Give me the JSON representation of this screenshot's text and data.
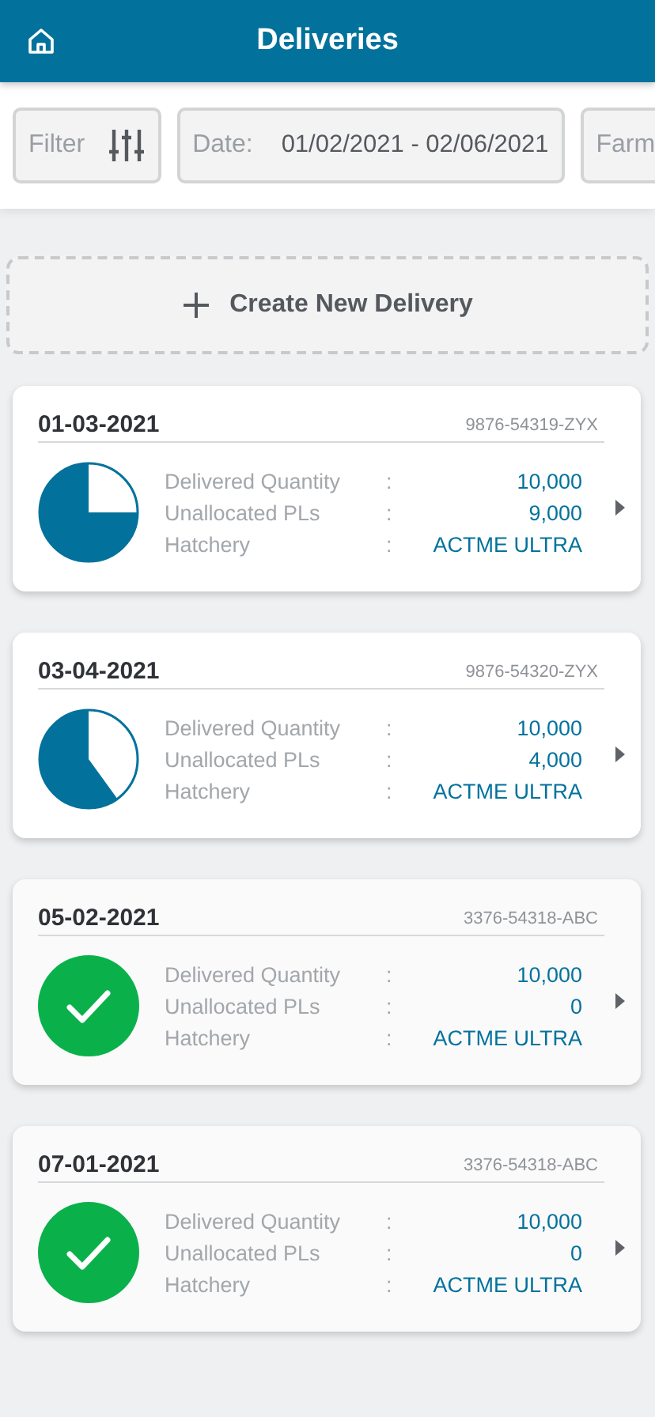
{
  "header": {
    "title": "Deliveries"
  },
  "filters": [
    {
      "kind": "filter",
      "label": "Filter"
    },
    {
      "kind": "date",
      "label": "Date:",
      "value": "01/02/2021 - 02/06/2021"
    },
    {
      "kind": "plain",
      "label": "Farm"
    }
  ],
  "create_button": {
    "label": "Create New Delivery"
  },
  "deliveries": [
    {
      "kind": "mostly-filled",
      "date": "01-03-2021",
      "code": "9876-54319-ZYX",
      "rows": [
        {
          "label": "Delivered Quantity",
          "separator": ":",
          "value": "10,000"
        },
        {
          "label": "Unallocated PLs",
          "separator": ":",
          "value": "9,000"
        },
        {
          "label": "Hatchery",
          "separator": ":",
          "value": "ACTME ULTRA"
        }
      ]
    },
    {
      "kind": "half-filled",
      "date": "03-04-2021",
      "code": "9876-54320-ZYX",
      "rows": [
        {
          "label": "Delivered Quantity",
          "separator": ":",
          "value": "10,000"
        },
        {
          "label": "Unallocated PLs",
          "separator": ":",
          "value": "4,000"
        },
        {
          "label": "Hatchery",
          "separator": ":",
          "value": "ACTME ULTRA"
        }
      ]
    },
    {
      "kind": "complete",
      "date": "05-02-2021",
      "code": "3376-54318-ABC",
      "rows": [
        {
          "label": "Delivered Quantity",
          "separator": ":",
          "value": "10,000"
        },
        {
          "label": "Unallocated PLs",
          "separator": ":",
          "value": "0"
        },
        {
          "label": "Hatchery",
          "separator": ":",
          "value": "ACTME ULTRA"
        }
      ]
    },
    {
      "kind": "complete",
      "date": "07-01-2021",
      "code": "3376-54318-ABC",
      "rows": [
        {
          "label": "Delivered Quantity",
          "separator": ":",
          "value": "10,000"
        },
        {
          "label": "Unallocated PLs",
          "separator": ":",
          "value": "0"
        },
        {
          "label": "Hatchery",
          "separator": ":",
          "value": "ACTME ULTRA"
        }
      ]
    }
  ]
}
